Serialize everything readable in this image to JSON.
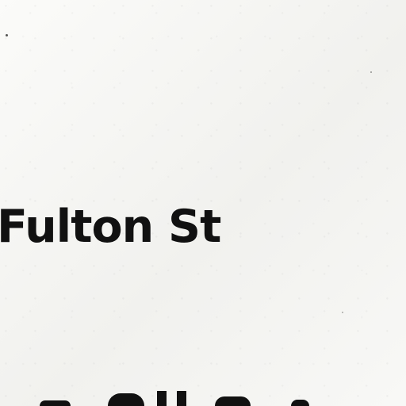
{
  "image": {
    "visible_text": {
      "street_name": "Fulton St"
    },
    "colors": {
      "paper": "#f7f7f5",
      "ink": "#111111"
    }
  }
}
